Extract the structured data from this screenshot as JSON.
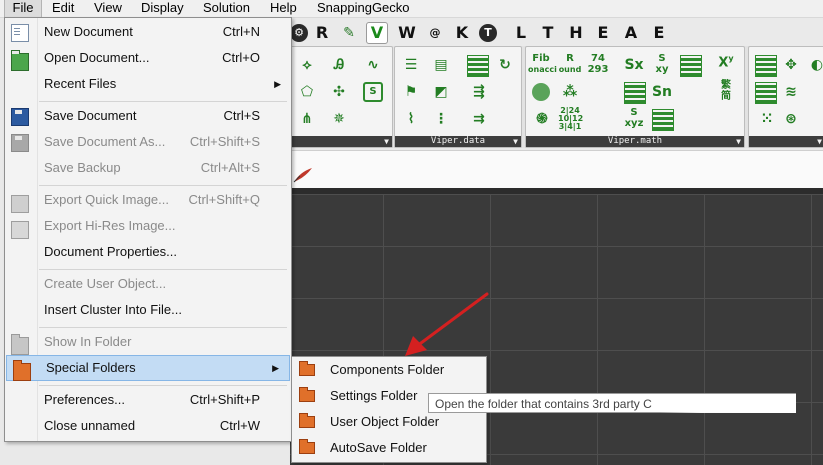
{
  "menubar": {
    "items": [
      "File",
      "Edit",
      "View",
      "Display",
      "Solution",
      "Help",
      "SnappingGecko"
    ]
  },
  "tabs": {
    "items": [
      "R",
      "V",
      "W",
      "@",
      "K",
      "T",
      "L",
      "T",
      "H",
      "E",
      "A",
      "E"
    ]
  },
  "ribbon": {
    "panel_data_caption": "Viper.data",
    "panel_math_caption": "Viper.math",
    "math_labels": [
      "Fib",
      "onacci",
      "ound",
      "74",
      "293",
      "Sx",
      "xy",
      "X",
      "y",
      "Sn",
      "xyz",
      "繁",
      "简",
      "2|24",
      "10|12",
      "3|4|1"
    ]
  },
  "file_menu": {
    "items": [
      {
        "label": "New Document",
        "shortcut": "Ctrl+N",
        "icon": "new-document-icon"
      },
      {
        "label": "Open Document...",
        "shortcut": "Ctrl+O",
        "icon": "open-folder-icon"
      },
      {
        "label": "Recent Files",
        "submenu": true
      },
      {
        "label": "Save Document",
        "shortcut": "Ctrl+S",
        "icon": "save-disk-icon"
      },
      {
        "label": "Save Document As...",
        "shortcut": "Ctrl+Shift+S",
        "icon": "save-as-disk-icon",
        "disabled": true
      },
      {
        "label": "Save Backup",
        "shortcut": "Ctrl+Alt+S",
        "disabled": true
      },
      {
        "label": "Export Quick Image...",
        "shortcut": "Ctrl+Shift+Q",
        "icon": "quick-image-icon",
        "disabled": true
      },
      {
        "label": "Export Hi-Res Image...",
        "icon": "hires-image-icon",
        "disabled": true
      },
      {
        "label": "Document Properties..."
      },
      {
        "label": "Create User Object...",
        "disabled": true
      },
      {
        "label": "Insert Cluster Into File..."
      },
      {
        "label": "Show In Folder",
        "icon": "folder-icon",
        "disabled": true
      },
      {
        "label": "Special Folders",
        "submenu": true,
        "highlighted": true,
        "icon": "folder-icon"
      },
      {
        "label": "Preferences...",
        "shortcut": "Ctrl+Shift+P"
      },
      {
        "label": "Close unnamed",
        "shortcut": "Ctrl+W"
      }
    ]
  },
  "special_folders_menu": {
    "items": [
      "Components Folder",
      "Settings Folder",
      "User Object Folder",
      "AutoSave Folder"
    ]
  },
  "tooltip": {
    "text": "Open the folder that contains 3rd party C"
  },
  "colors": {
    "highlight": "#c3dcf4",
    "folder_orange": "#e0702a",
    "arrow_red": "#d42020",
    "canvas_bg": "#3a3a3a",
    "ribbon_icon_green": "#237d23"
  }
}
